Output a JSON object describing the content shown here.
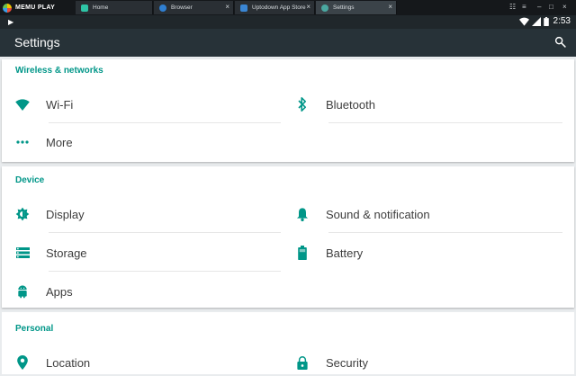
{
  "emulator": {
    "brand": "MEMU PLAY",
    "tabs": [
      {
        "label": "Home"
      },
      {
        "label": "Browser"
      },
      {
        "label": "Uptodown App Store"
      },
      {
        "label": "Settings"
      }
    ]
  },
  "statusbar": {
    "time": "2:53"
  },
  "actionbar": {
    "title": "Settings"
  },
  "sections": [
    {
      "title": "Wireless & networks",
      "items": [
        "Wi-Fi",
        "Bluetooth",
        "More"
      ]
    },
    {
      "title": "Device",
      "items": [
        "Display",
        "Sound & notification",
        "Storage",
        "Battery",
        "Apps"
      ]
    },
    {
      "title": "Personal",
      "items": [
        "Location",
        "Security"
      ]
    }
  ],
  "colors": {
    "accent": "#009688",
    "actionbar": "#273238",
    "statusbar": "#20272b"
  }
}
